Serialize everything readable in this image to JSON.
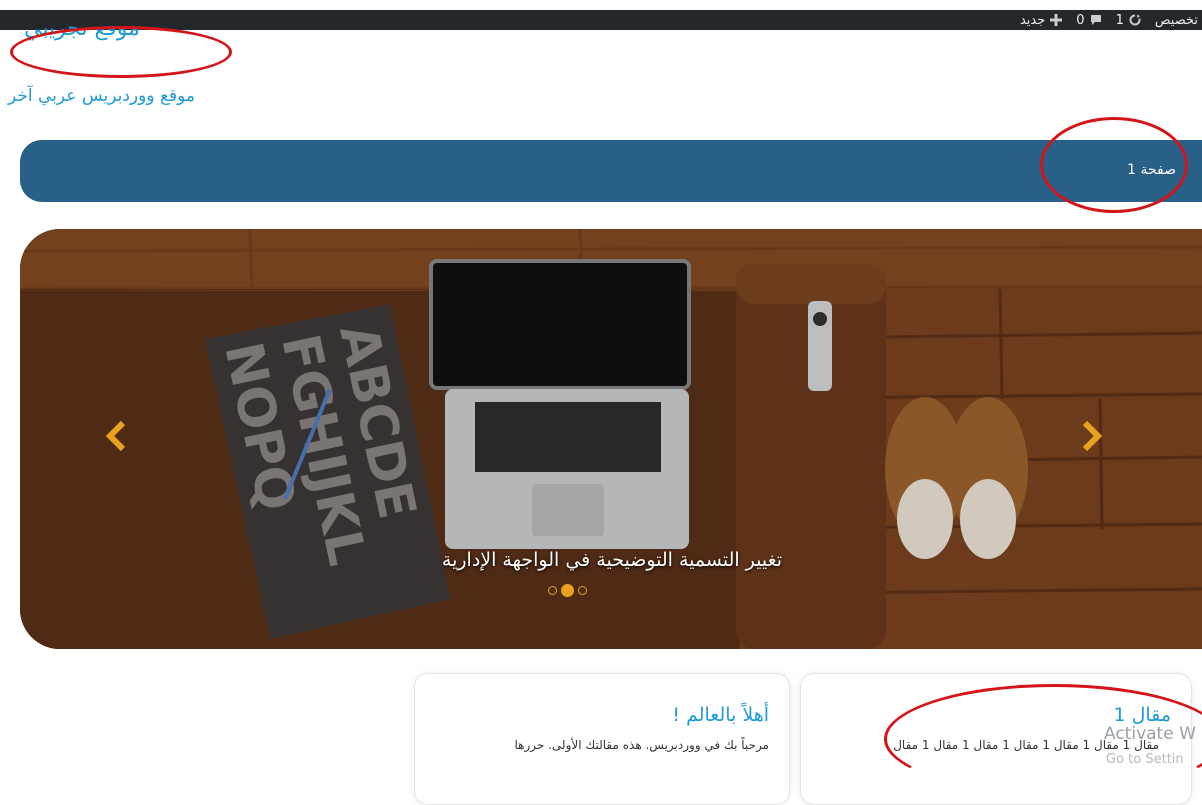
{
  "admin_bar": {
    "customize": "تخصيص",
    "updates_count": "1",
    "comments_count": "0",
    "new_label": "جديد"
  },
  "site": {
    "title": "موقع تجريبي",
    "tagline": "موقع ووردبريس عربي آخر"
  },
  "nav": {
    "items": [
      {
        "label": "صفحة 1"
      }
    ]
  },
  "slider": {
    "caption": "تغيير التسمية التوضيحية في الواجهة الإدارية",
    "slide_count": 3,
    "active_index": 1,
    "arrow_color": "#e8a21d"
  },
  "posts": [
    {
      "title": "أهلاً بالعالم !",
      "excerpt": "مرحباً بك في ووردبريس. هذه مقالتك الأولى. حررها"
    },
    {
      "title": "مقال 1",
      "excerpt": "مقال 1 مقال 1 مقال 1 مقال 1 مقال 1 مقال 1 مقال"
    }
  ],
  "watermark": {
    "line1": "Activate W",
    "line2": "Go to Settin"
  },
  "colors": {
    "link_blue": "#1e9bd7",
    "nav_bg": "#296087",
    "annotation_red": "#d5141a"
  }
}
